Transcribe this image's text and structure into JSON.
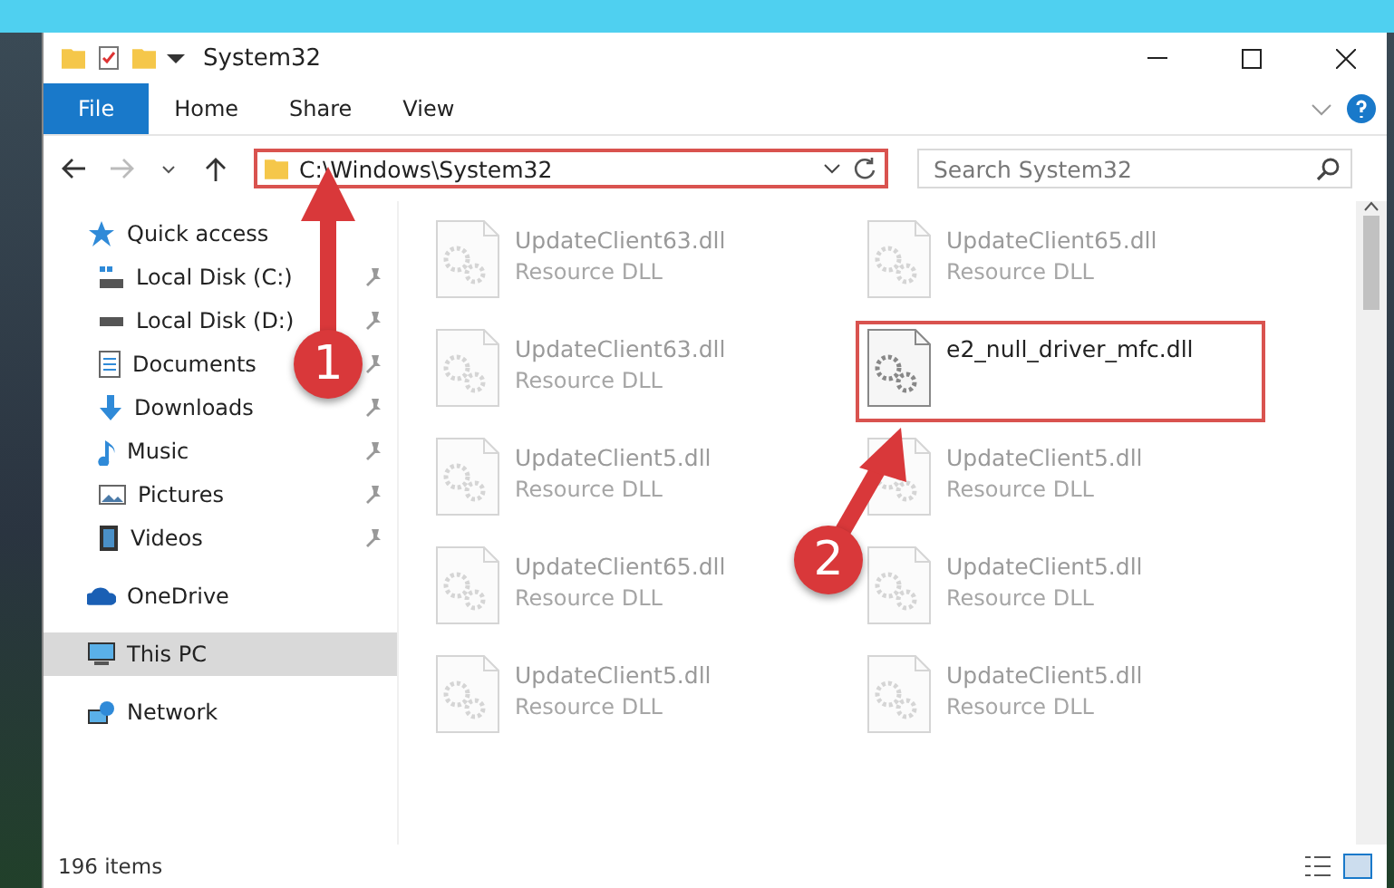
{
  "window": {
    "title": "System32"
  },
  "ribbon": {
    "tabs": [
      {
        "label": "File",
        "selected": true
      },
      {
        "label": "Home",
        "selected": false
      },
      {
        "label": "Share",
        "selected": false
      },
      {
        "label": "View",
        "selected": false
      }
    ]
  },
  "address_bar": {
    "path": "C:\\Windows\\System32",
    "highlighted": true
  },
  "search": {
    "placeholder": "Search System32"
  },
  "nav": [
    {
      "label": "Quick access",
      "selected": false,
      "children": [
        {
          "label": "Local Disk (C:)",
          "pinned": true
        },
        {
          "label": "Local Disk (D:)",
          "pinned": true
        },
        {
          "label": "Documents",
          "pinned": true
        },
        {
          "label": "Downloads",
          "pinned": true
        },
        {
          "label": "Music",
          "pinned": true
        },
        {
          "label": "Pictures",
          "pinned": true
        },
        {
          "label": "Videos",
          "pinned": true
        }
      ]
    },
    {
      "label": "OneDrive",
      "selected": false
    },
    {
      "label": "This PC",
      "selected": true
    },
    {
      "label": "Network",
      "selected": false
    }
  ],
  "files": [
    {
      "name": "UpdateClient63.dll",
      "type": "Resource DLL",
      "blurred": true,
      "highlighted": false
    },
    {
      "name": "UpdateClient65.dll",
      "type": "Resource DLL",
      "blurred": true,
      "highlighted": false
    },
    {
      "name": "UpdateClient63.dll",
      "type": "Resource DLL",
      "blurred": true,
      "highlighted": false
    },
    {
      "name": "e2_null_driver_mfc.dll",
      "blurred": false,
      "highlighted": true
    },
    {
      "name": "UpdateClient5.dll",
      "type": "Resource DLL",
      "blurred": true,
      "highlighted": false
    },
    {
      "name": "UpdateClient5.dll",
      "type": "Resource DLL",
      "blurred": true,
      "highlighted": false
    },
    {
      "name": "UpdateClient65.dll",
      "type": "Resource DLL",
      "blurred": true,
      "highlighted": false
    },
    {
      "name": "UpdateClient5.dll",
      "type": "Resource DLL",
      "blurred": true,
      "highlighted": false
    },
    {
      "name": "UpdateClient5.dll",
      "type": "Resource DLL",
      "blurred": true,
      "highlighted": false
    },
    {
      "name": "UpdateClient5.dll",
      "type": "Resource DLL",
      "blurred": true,
      "highlighted": false
    }
  ],
  "status_bar": {
    "item_count": "196 items"
  },
  "annotations": [
    {
      "number": "1"
    },
    {
      "number": "2"
    }
  ]
}
